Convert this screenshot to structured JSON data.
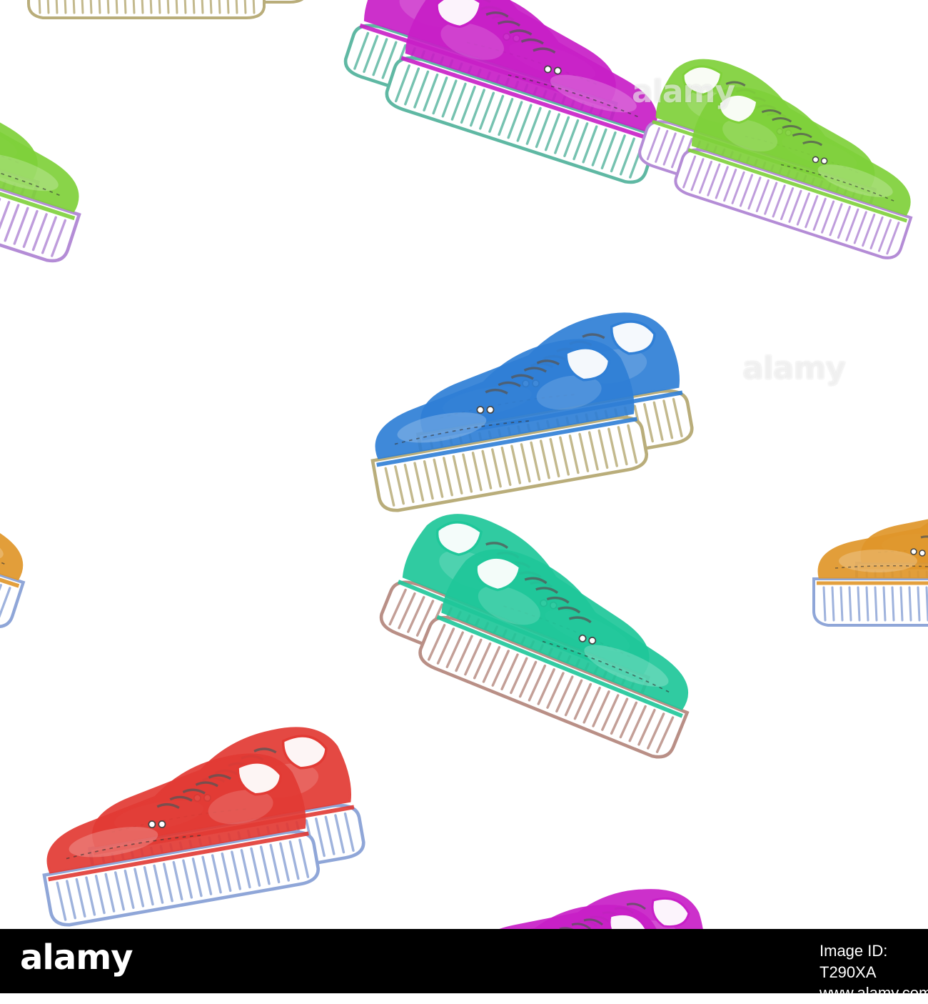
{
  "illustration": {
    "style": "watercolor seamless pattern",
    "subject": "pairs of platform sneakers",
    "colors": {
      "green": "#7fd13a",
      "magenta": "#c81fc7",
      "blue": "#2f7fd6",
      "orange": "#e0962a",
      "red": "#e23a34",
      "teal": "#1fc79a",
      "sole_blue": "#8fa6d8",
      "sole_violet": "#b48cd6",
      "sole_teal": "#5fb8a3",
      "sole_tan": "#b9ad7a",
      "sole_brown": "#b98f86"
    }
  },
  "watermark": {
    "overlay_text": "alamy",
    "overlay_text_2": "alamy"
  },
  "footer": {
    "logo": "alamy",
    "image_id": "Image ID: T290XA",
    "site": "www.alamy.com"
  }
}
